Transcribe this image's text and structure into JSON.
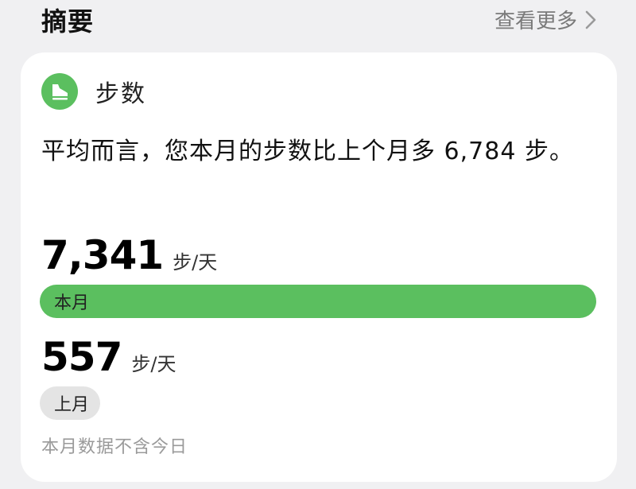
{
  "header": {
    "title": "摘要",
    "more_label": "查看更多"
  },
  "card": {
    "icon": "shoe-icon",
    "title": "步数",
    "summary": "平均而言，您本月的步数比上个月多 6,784 步。",
    "current": {
      "value": "7,341",
      "unit": "步/天",
      "bar_label": "本月",
      "steps": 7341
    },
    "previous": {
      "value": "557",
      "unit": "步/天",
      "bar_label": "上月",
      "steps": 557
    },
    "footnote": "本月数据不含今日"
  },
  "colors": {
    "accent": "#5bbf5f",
    "background": "#f0f0f2",
    "card": "#ffffff",
    "muted_bar": "#e4e4e4"
  }
}
